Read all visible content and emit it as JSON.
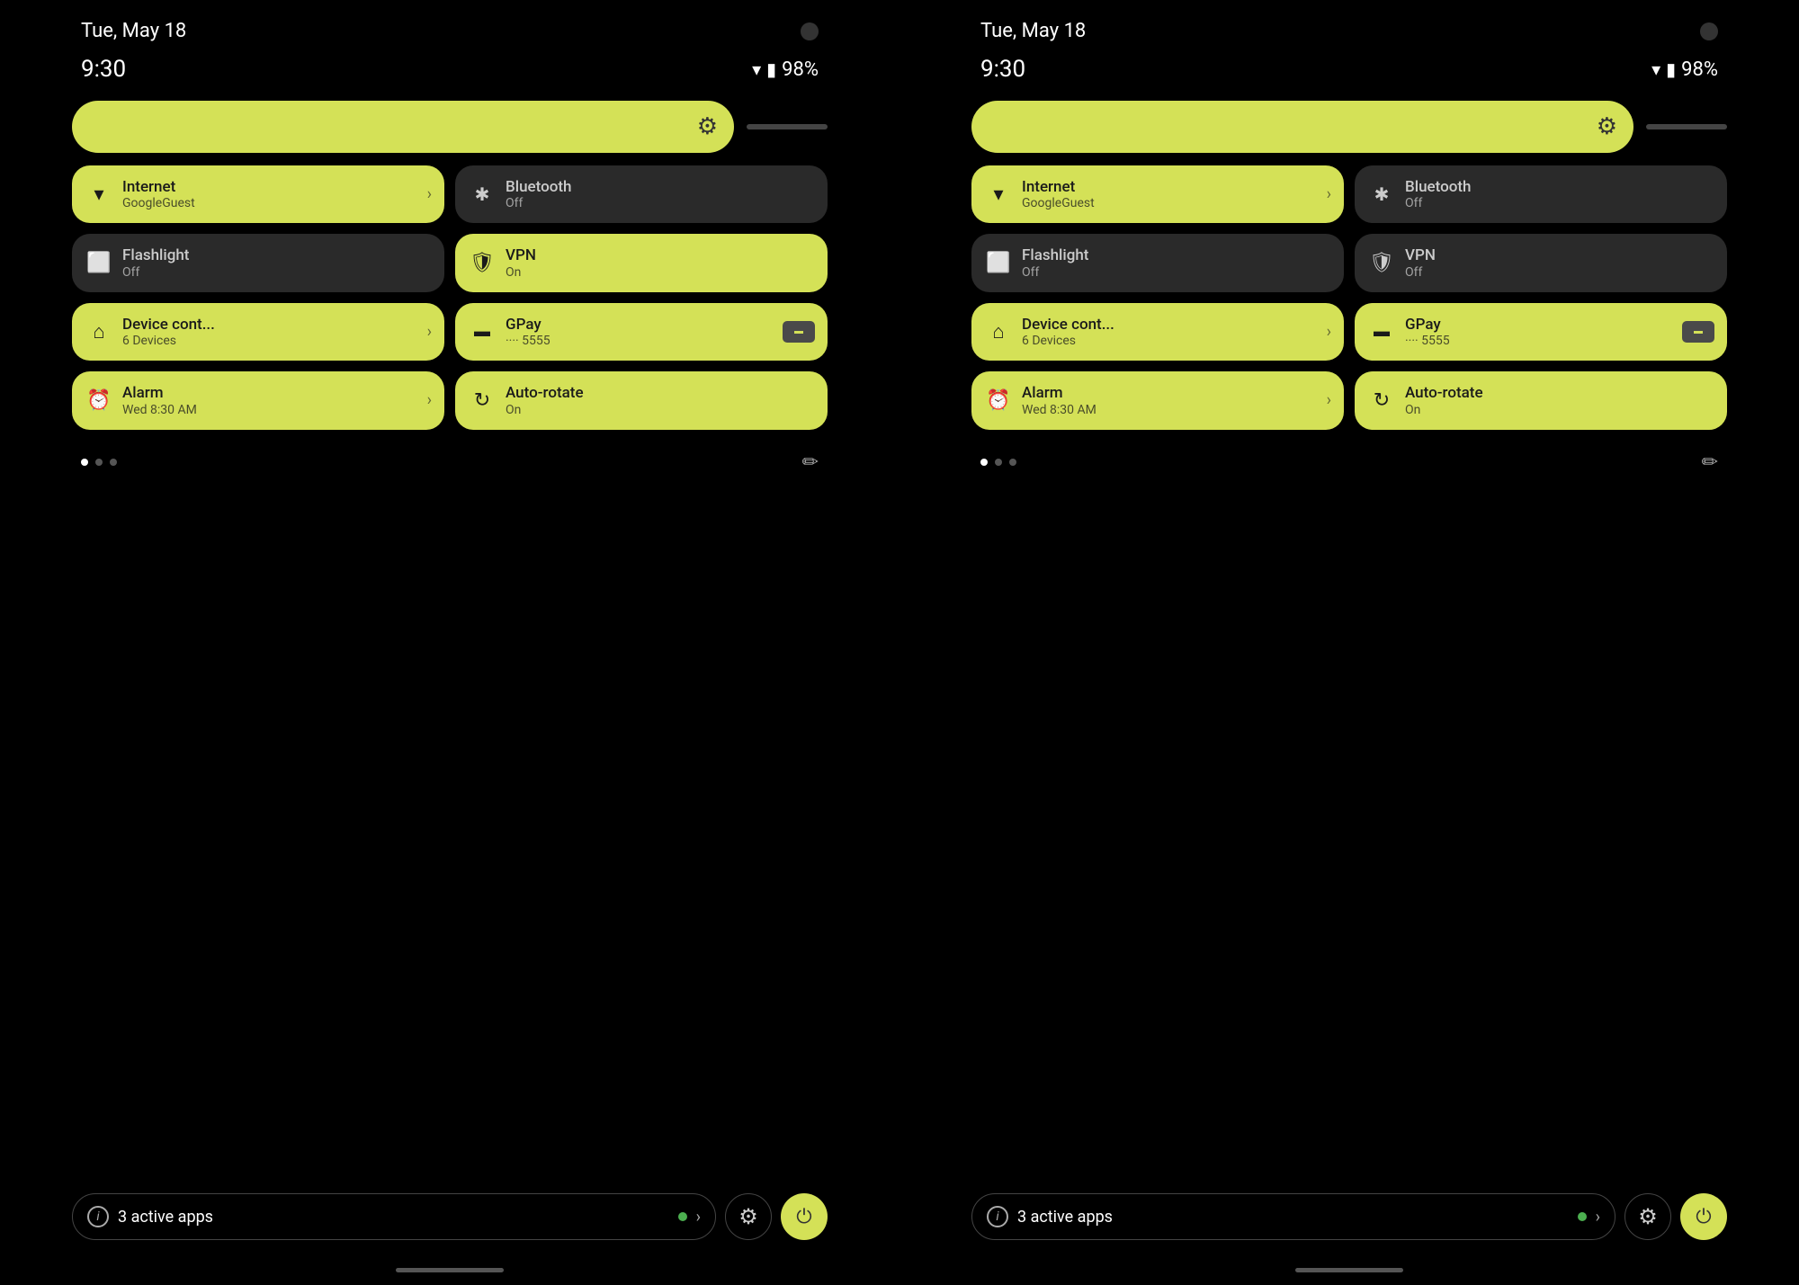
{
  "phones": [
    {
      "id": "phone-left",
      "status_bar": {
        "date": "Tue, May 18",
        "time": "9:30",
        "battery_pct": "98%"
      },
      "brightness": {
        "gear_label": "⚙"
      },
      "tiles": [
        {
          "id": "internet",
          "icon": "wifi",
          "title": "Internet",
          "subtitle": "GoogleGuest",
          "state": "active",
          "has_arrow": true,
          "has_card": false
        },
        {
          "id": "bluetooth",
          "icon": "bluetooth",
          "title": "Bluetooth",
          "subtitle": "Off",
          "state": "inactive",
          "has_arrow": false,
          "has_card": false
        },
        {
          "id": "flashlight",
          "icon": "flashlight",
          "title": "Flashlight",
          "subtitle": "Off",
          "state": "inactive",
          "has_arrow": false,
          "has_card": false
        },
        {
          "id": "vpn",
          "icon": "vpn",
          "title": "VPN",
          "subtitle": "On",
          "state": "active",
          "has_arrow": false,
          "has_card": false
        },
        {
          "id": "device-control",
          "icon": "home",
          "title": "Device cont...",
          "subtitle": "6 Devices",
          "state": "active",
          "has_arrow": true,
          "has_card": false
        },
        {
          "id": "gpay",
          "icon": "card",
          "title": "GPay",
          "subtitle": "···· 5555",
          "state": "active",
          "has_arrow": false,
          "has_card": true
        },
        {
          "id": "alarm",
          "icon": "alarm",
          "title": "Alarm",
          "subtitle": "Wed 8:30 AM",
          "state": "active",
          "has_arrow": true,
          "has_card": false
        },
        {
          "id": "autorotate",
          "icon": "rotate",
          "title": "Auto-rotate",
          "subtitle": "On",
          "state": "active",
          "has_arrow": false,
          "has_card": false
        }
      ],
      "bottom": {
        "active_apps_label": "3 active apps",
        "info_symbol": "i"
      }
    },
    {
      "id": "phone-right",
      "status_bar": {
        "date": "Tue, May 18",
        "time": "9:30",
        "battery_pct": "98%"
      },
      "brightness": {
        "gear_label": "⚙"
      },
      "tiles": [
        {
          "id": "internet",
          "icon": "wifi",
          "title": "Internet",
          "subtitle": "GoogleGuest",
          "state": "active",
          "has_arrow": true,
          "has_card": false
        },
        {
          "id": "bluetooth",
          "icon": "bluetooth",
          "title": "Bluetooth",
          "subtitle": "Off",
          "state": "inactive",
          "has_arrow": false,
          "has_card": false
        },
        {
          "id": "flashlight",
          "icon": "flashlight",
          "title": "Flashlight",
          "subtitle": "Off",
          "state": "inactive",
          "has_arrow": false,
          "has_card": false
        },
        {
          "id": "vpn",
          "icon": "vpn",
          "title": "VPN",
          "subtitle": "Off",
          "state": "inactive",
          "has_arrow": false,
          "has_card": false
        },
        {
          "id": "device-control",
          "icon": "home",
          "title": "Device cont...",
          "subtitle": "6 Devices",
          "state": "active",
          "has_arrow": true,
          "has_card": false
        },
        {
          "id": "gpay",
          "icon": "card",
          "title": "GPay",
          "subtitle": "···· 5555",
          "state": "active",
          "has_arrow": false,
          "has_card": true
        },
        {
          "id": "alarm",
          "icon": "alarm",
          "title": "Alarm",
          "subtitle": "Wed 8:30 AM",
          "state": "active",
          "has_arrow": true,
          "has_card": false
        },
        {
          "id": "autorotate",
          "icon": "rotate",
          "title": "Auto-rotate",
          "subtitle": "On",
          "state": "active",
          "has_arrow": false,
          "has_card": false
        }
      ],
      "bottom": {
        "active_apps_label": "3 active apps",
        "info_symbol": "i"
      }
    }
  ],
  "colors": {
    "active_tile": "#d4e157",
    "inactive_tile": "#2a2a2a",
    "background": "#000000",
    "text_dark": "#1a1a1a",
    "text_light": "#ffffff"
  },
  "icons": {
    "wifi": "▼",
    "bluetooth": "✱",
    "flashlight": "🔦",
    "vpn": "🛡",
    "home": "⌂",
    "card": "💳",
    "alarm": "⏰",
    "rotate": "↻",
    "gear": "⚙",
    "power": "⏻",
    "info": "i",
    "arrow_right": "›",
    "pencil": "✏"
  }
}
